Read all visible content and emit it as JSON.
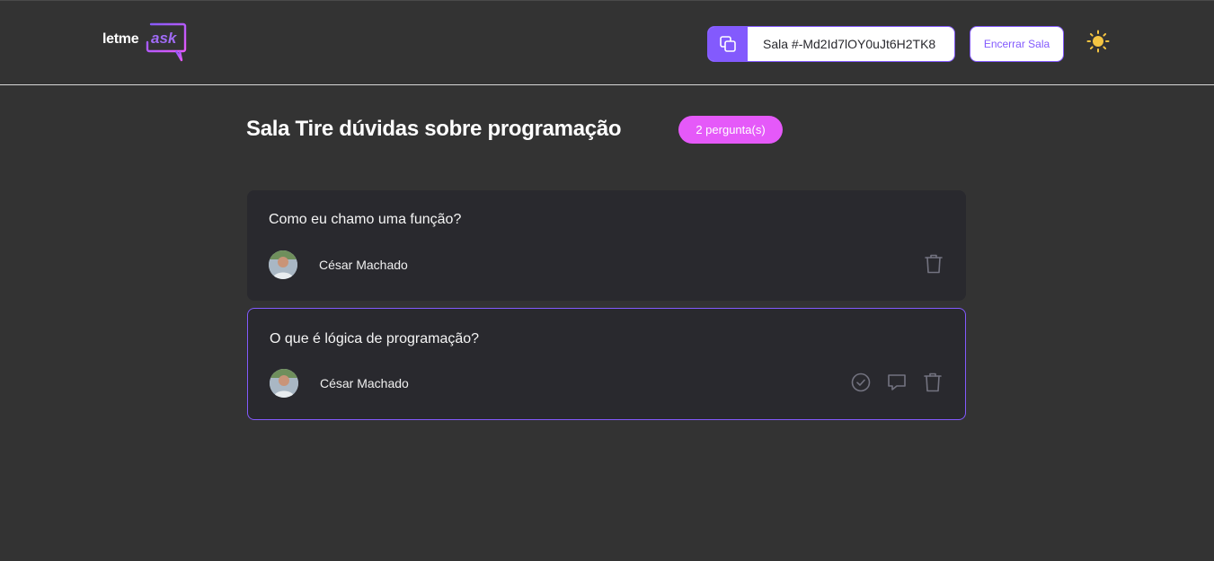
{
  "header": {
    "logo": {
      "text_a": "letme",
      "text_b": "ask",
      "accent": "#835afd"
    },
    "room_code": {
      "label": "Sala #-Md2Id7lOY0uJt6H2TK8",
      "icon": "copy-icon"
    },
    "close_room_label": "Encerrar Sala",
    "theme_toggle_icon": "sun-icon"
  },
  "room": {
    "title": "Sala Tire dúvidas sobre programação",
    "question_count_label": "2 pergunta(s)"
  },
  "questions": [
    {
      "content": "Como eu chamo uma função?",
      "author": "César Machado",
      "highlighted": false,
      "actions": [
        "delete-icon"
      ]
    },
    {
      "content": "O que é lógica de programação?",
      "author": "César Machado",
      "highlighted": true,
      "actions": [
        "check-circle-icon",
        "comment-icon",
        "delete-icon"
      ]
    }
  ],
  "colors": {
    "background": "#333333",
    "card": "#29292e",
    "purple": "#835afd",
    "pink": "#e559f9",
    "sun": "#f5c542"
  }
}
